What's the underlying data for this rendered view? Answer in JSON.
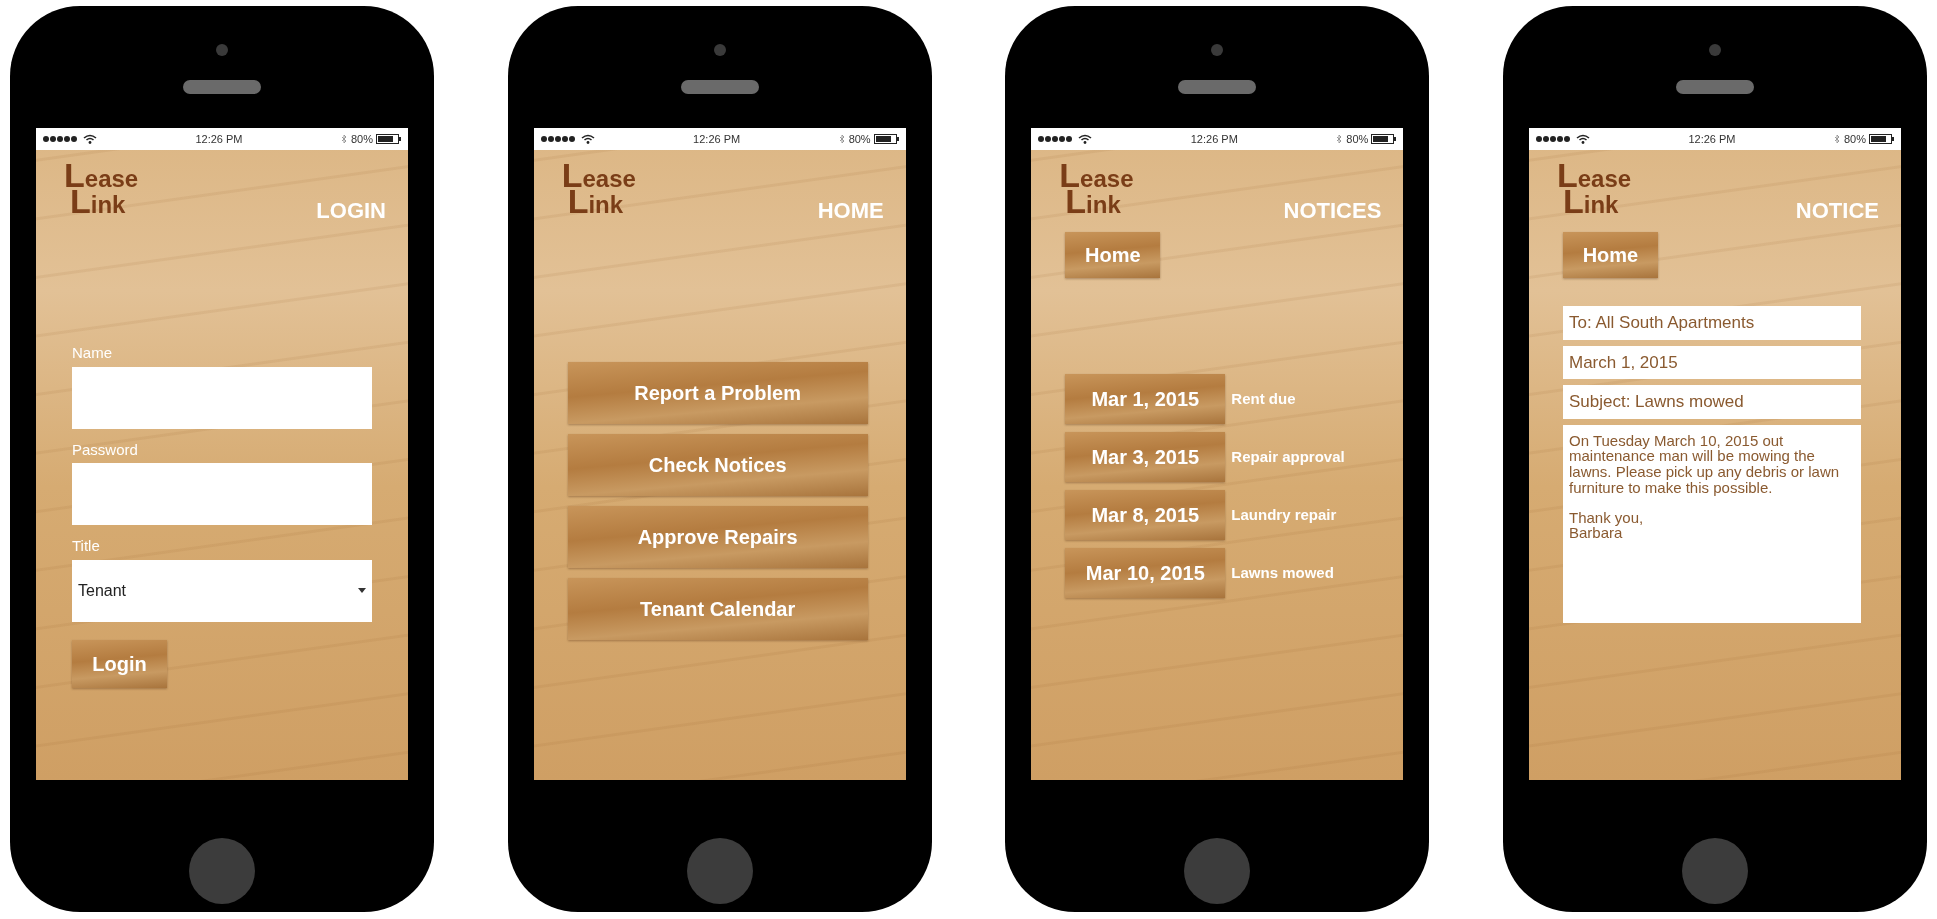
{
  "phones": [
    {
      "kind": "login",
      "status_bar": {
        "time": "12:26 PM",
        "battery": "80%"
      },
      "logo": [
        "Lease",
        "Link"
      ],
      "title": "LOGIN",
      "fields": [
        {
          "label": "Name"
        },
        {
          "label": "Password"
        }
      ],
      "select": {
        "label": "Title",
        "value": "Tenant"
      },
      "button": "Login"
    },
    {
      "kind": "home",
      "status_bar": {
        "time": "12:26 PM",
        "battery": "80%"
      },
      "logo": [
        "Lease",
        "Link"
      ],
      "title": "HOME",
      "menu": [
        "Report a Problem",
        "Check Notices",
        "Approve Repairs",
        "Tenant Calendar"
      ]
    },
    {
      "kind": "notices",
      "status_bar": {
        "time": "12:26 PM",
        "battery": "80%"
      },
      "logo": [
        "Lease",
        "Link"
      ],
      "title": "NOTICES",
      "home_button": "Home",
      "notices": [
        {
          "date": "Mar 1, 2015",
          "subject": "Rent due"
        },
        {
          "date": "Mar 3, 2015",
          "subject": "Repair approval"
        },
        {
          "date": "Mar 8, 2015",
          "subject": "Laundry repair"
        },
        {
          "date": "Mar 10, 2015",
          "subject": "Lawns mowed"
        }
      ]
    },
    {
      "kind": "notice",
      "status_bar": {
        "time": "12:26 PM",
        "battery": "80%"
      },
      "logo": [
        "Lease",
        "Link"
      ],
      "title": "NOTICE",
      "home_button": "Home",
      "to": "To: All South Apartments",
      "date": "March 1, 2015",
      "subject": "Subject: Lawns mowed",
      "body": "On Tuesday March 10, 2015 out maintenance man will be mowing the lawns.  Please pick up any debris or lawn furniture to make this possible.",
      "signature": [
        "Thank you,",
        "Barbara"
      ]
    }
  ]
}
